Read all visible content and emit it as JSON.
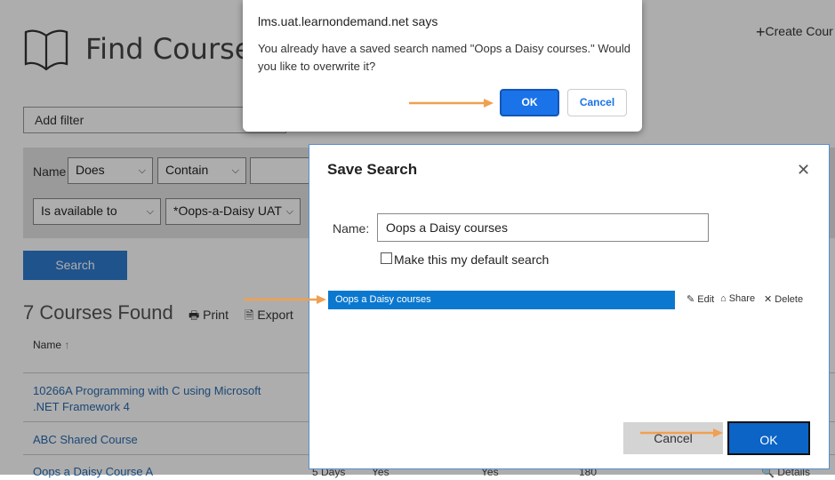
{
  "page": {
    "title": "Find Courses",
    "create_label": "Create Cour",
    "add_filter_label": "Add filter",
    "filter": {
      "name_label": "Name",
      "op1": "Does",
      "op2": "Contain",
      "availability": "Is available to",
      "audience": "*Oops-a-Daisy UAT"
    },
    "search_button": "Search",
    "results_count": "7 Courses Found",
    "print_label": "Print",
    "export_label": "Export",
    "column_name": "Name",
    "rows": [
      {
        "name_line1": "10266A Programming with C using Microsoft",
        "name_line2": ".NET Framework 4"
      },
      {
        "name_line1": "ABC Shared Course",
        "name_line2": ""
      },
      {
        "name_line1": "Oops a Daisy Course A",
        "name_line2": "",
        "col2": "5 Days",
        "col3": "Yes",
        "col4": "Yes",
        "col5": "180",
        "details": "Details"
      }
    ]
  },
  "save_search_modal": {
    "title": "Save Search",
    "name_label": "Name:",
    "name_value": "Oops a Daisy courses",
    "default_checkbox_label": "Make this my default search",
    "saved_searches": [
      "Oops a Daisy courses"
    ],
    "edit_label": "Edit",
    "share_label": "Share",
    "delete_label": "Delete",
    "cancel_label": "Cancel",
    "ok_label": "OK"
  },
  "browser_alert": {
    "header": "lms.uat.learnondemand.net says",
    "message": "You already have a saved search named \"Oops a Daisy courses.\" Would you like to overwrite it?",
    "ok_label": "OK",
    "cancel_label": "Cancel"
  },
  "colors": {
    "accent_blue": "#0b78d0",
    "annotation_arrow": "#f0a050",
    "alert_ok": "#1a73e8"
  }
}
